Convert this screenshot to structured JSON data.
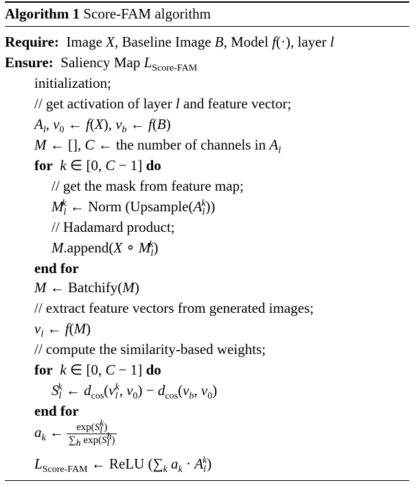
{
  "header": {
    "algo_label": "Algorithm 1",
    "algo_name": "Score-FAM algorithm"
  },
  "kw": {
    "require": "Require:",
    "ensure": "Ensure:",
    "for": "for",
    "do": "do",
    "end_for": "end for"
  },
  "require_text": "Image X, Baseline Image B, Model f(·), layer l",
  "ensure_text": "Saliency Map L",
  "ensure_sub": "Score-FAM",
  "lines": {
    "init": "initialization;",
    "c1": "// get activation of layer l and feature vector;",
    "c2": "// get the mask from feature map;",
    "c3": "// Hadamard product;",
    "c4": "// extract feature vectors from generated images;",
    "c5": "// compute the similarity-based weights;"
  },
  "math": {
    "activation": "Al, v0 ← f(X), vb ← f(B)",
    "init_m_lhs": "M ← [], C ←",
    "init_m_text": "the number of channels in",
    "for_range": "k ∈ [0, C − 1]",
    "mask_lhs": "M",
    "norm": "Norm",
    "upsample": "Upsample",
    "append_text": "append",
    "batchify": "Batchify",
    "relu": "ReLU",
    "final_sub": "Score-FAM"
  }
}
